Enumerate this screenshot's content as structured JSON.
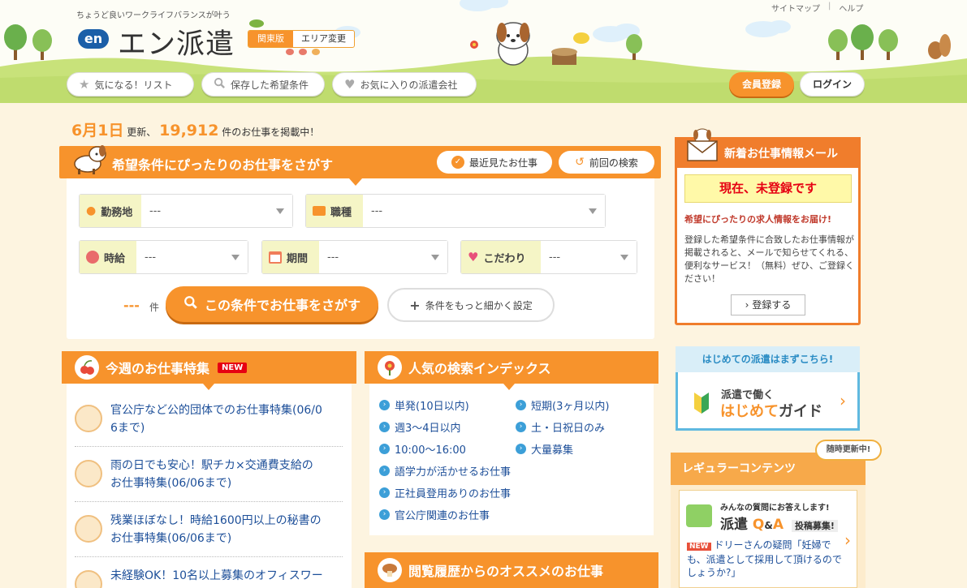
{
  "header": {
    "tagline": "ちょうど良いワークライフバランスが叶う",
    "logo_mark": "en",
    "logo_text": "エン派遣",
    "area_current": "関東版",
    "area_change": "エリア変更",
    "top_links": {
      "sitemap": "サイトマップ",
      "separator": "|",
      "help": "ヘルプ"
    },
    "nav": {
      "favorites": "気になる！リスト",
      "saved_conditions": "保存した希望条件",
      "favorite_companies": "お気に入りの派遣会社"
    },
    "register": "会員登録",
    "login": "ログイン"
  },
  "update": {
    "date": "6月1日",
    "text1": "更新、",
    "count": "19,912",
    "text2": "件のお仕事を掲載中！"
  },
  "search": {
    "title": "希望条件にぴったりのお仕事をさがす",
    "recent_button": "最近見たお仕事",
    "previous_button": "前回の検索",
    "fields": {
      "location": {
        "label": "勤務地",
        "value": "---"
      },
      "job_type": {
        "label": "職種",
        "value": "---"
      },
      "wage": {
        "label": "時給",
        "value": "---"
      },
      "period": {
        "label": "期間",
        "value": "---"
      },
      "preference": {
        "label": "こだわり",
        "value": "---"
      }
    },
    "count_value": "---",
    "count_unit": "件",
    "search_button": "この条件でお仕事をさがす",
    "detail_button": "条件をもっと細かく設定"
  },
  "feature": {
    "title": "今週のお仕事特集",
    "badge": "NEW",
    "items": [
      {
        "line1": "官公庁など公的団体でのお仕事特集(06/0",
        "line2": "6まで)"
      },
      {
        "line1": "雨の日でも安心！駅チカ×交通費支給の",
        "line2": "お仕事特集(06/06まで)"
      },
      {
        "line1": "残業ほぼなし！時給1600円以上の秘書の",
        "line2": "お仕事特集(06/06まで)"
      },
      {
        "line1": "未経験OK！10名以上募集のオフィスワー",
        "line2": ""
      }
    ]
  },
  "index": {
    "title": "人気の検索インデックス",
    "items": [
      "単発(10日以内)",
      "短期(3ヶ月以内)",
      "週3〜4日以内",
      "土・日祝日のみ",
      "10:00〜16:00",
      "大量募集",
      "語学力が活かせるお仕事",
      "正社員登用ありのお仕事",
      "官公庁関連のお仕事"
    ]
  },
  "history": {
    "title": "閲覧履歴からのオススメのお仕事"
  },
  "sidebar": {
    "mail": {
      "title": "新着お仕事情報メール",
      "status": "現在、未登録です",
      "subtitle": "希望にぴったりの求人情報をお届け!",
      "desc": "登録した希望条件に合致したお仕事情報が掲載されると、メールで知らせてくれる、便利なサービス！（無料）ぜひ、ご登録ください！",
      "button": "登録する"
    },
    "first": {
      "head": "はじめての派遣はまずこちら!",
      "line1": "派遣で働く",
      "hl": "はじめて",
      "line2": "ガイド"
    },
    "regular": {
      "title": "レギュラーコンテンツ",
      "badge": "随時更新中!",
      "qa_caption": "みんなの質問にお答えします!",
      "qa_title_a": "派遣",
      "qa_title_b": "Q",
      "qa_title_c": "&",
      "qa_title_d": "A",
      "qa_posting": "投稿募集!",
      "new_badge": "NEW",
      "qa_text": "ドリーさんの疑問「妊婦でも、派遣として採用して頂けるのでしょうか?」"
    }
  },
  "colors": {
    "accent": "#f7932c",
    "link": "#1d4f99",
    "grass": "#c8e27a",
    "cream": "#fdf4e0"
  }
}
